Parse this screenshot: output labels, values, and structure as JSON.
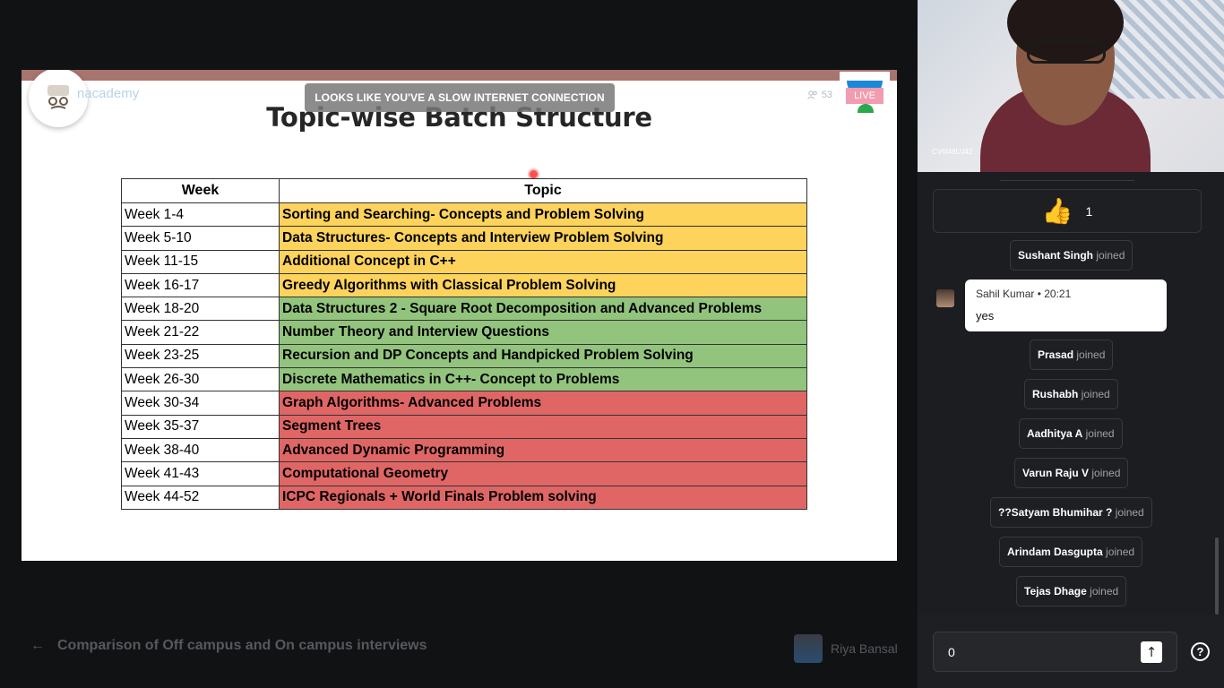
{
  "slide": {
    "brand_text": "nacademy",
    "viewer_count": "53",
    "live_label": "LIVE",
    "toast": "LOOKS LIKE YOU'VE A SLOW INTERNET CONNECTION",
    "title": "Topic-wise Batch Structure",
    "table": {
      "headers": [
        "Week",
        "Topic"
      ],
      "rows": [
        {
          "week": "Week 1-4",
          "topic": "Sorting and Searching- Concepts and Problem Solving",
          "color": "yellow"
        },
        {
          "week": "Week 5-10",
          "topic": "Data Structures- Concepts and Interview Problem Solving",
          "color": "yellow"
        },
        {
          "week": "Week 11-15",
          "topic": "Additional Concept in C++",
          "color": "yellow"
        },
        {
          "week": "Week 16-17",
          "topic": "Greedy Algorithms with Classical Problem Solving",
          "color": "yellow"
        },
        {
          "week": "Week 18-20",
          "topic": "Data Structures 2 - Square Root Decomposition and Advanced Problems",
          "color": "green"
        },
        {
          "week": "Week 21-22",
          "topic": "Number Theory and Interview Questions",
          "color": "green"
        },
        {
          "week": "Week 23-25",
          "topic": "Recursion and DP Concepts and Handpicked Problem Solving",
          "color": "green"
        },
        {
          "week": "Week 26-30",
          "topic": "Discrete Mathematics in C++- Concept to Problems",
          "color": "green"
        },
        {
          "week": "Week 30-34",
          "topic": "Graph Algorithms- Advanced Problems",
          "color": "red"
        },
        {
          "week": "Week 35-37",
          "topic": "Segment Trees",
          "color": "red"
        },
        {
          "week": "Week 38-40",
          "topic": "Advanced Dynamic Programming",
          "color": "red"
        },
        {
          "week": "Week 41-43",
          "topic": "Computational Geometry",
          "color": "red"
        },
        {
          "week": "Week 44-52",
          "topic": "ICPC Regionals + World Finals Problem solving",
          "color": "red"
        }
      ]
    }
  },
  "bottom": {
    "back_title": "Comparison of Off campus and On campus interviews",
    "educator_name": "Riya Bansal"
  },
  "video": {
    "label": "CV6I48UJ42"
  },
  "chat": {
    "reaction": {
      "emoji": "👍",
      "count": "1"
    },
    "joined_suffix": "joined",
    "message": {
      "author": "Sahil Kumar",
      "time": "20:21",
      "text": "yes"
    },
    "joins_before": [
      "Sushant Singh"
    ],
    "joins_after": [
      "Prasad",
      "Rushabh",
      "Aadhitya A",
      "Varun Raju V",
      "??Satyam Bhumihar ?",
      "Arindam Dasgupta",
      "Tejas Dhage"
    ],
    "input_value": "0",
    "help_label": "?"
  },
  "colors": {
    "yellow": "#fdd35c",
    "green": "#93c47d",
    "red": "#e06666"
  }
}
